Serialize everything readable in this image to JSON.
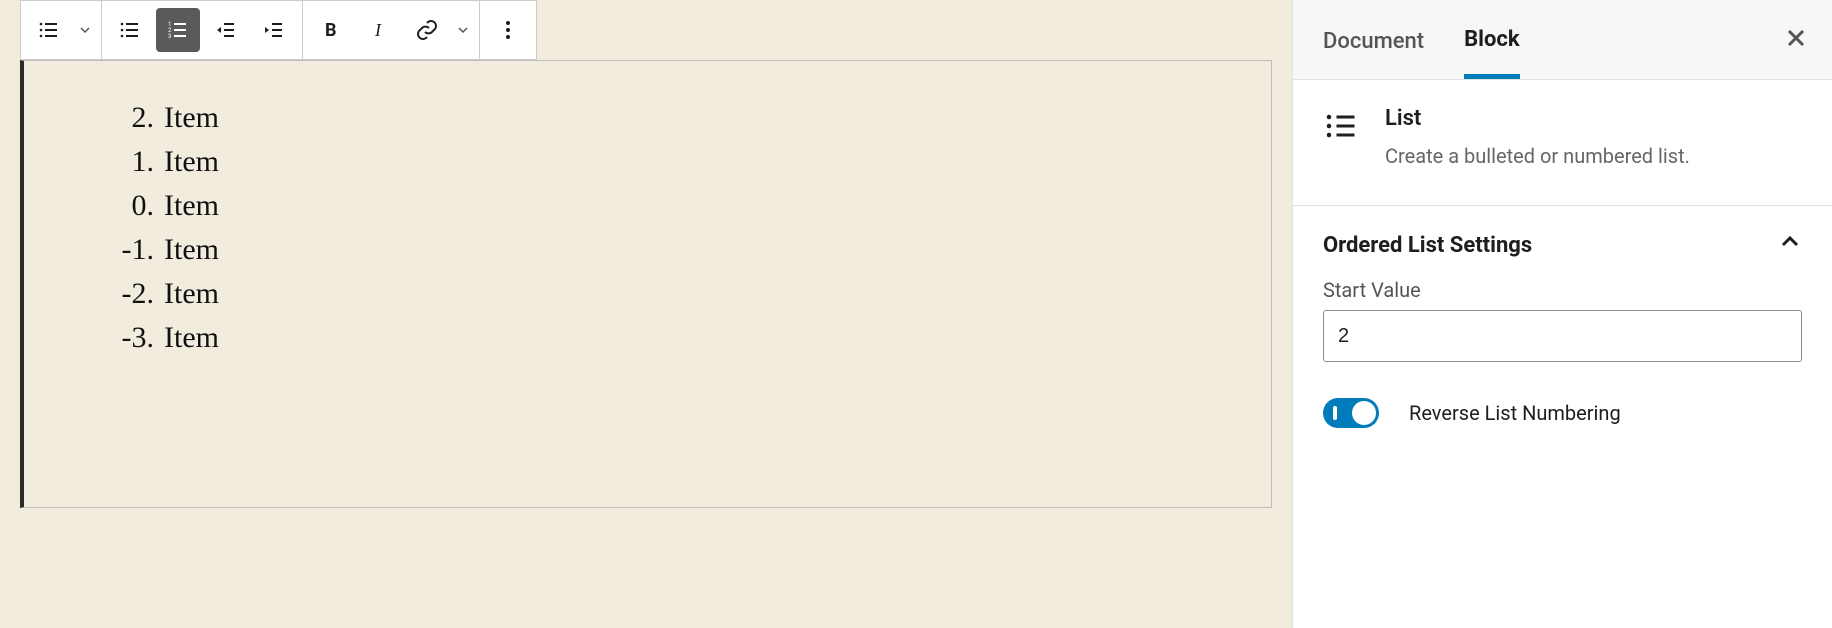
{
  "toolbar": {
    "block_type": "list",
    "list_type": "ordered"
  },
  "list": {
    "items": [
      {
        "num": "2.",
        "text": "Item"
      },
      {
        "num": "1.",
        "text": "Item"
      },
      {
        "num": "0.",
        "text": "Item"
      },
      {
        "num": "-1.",
        "text": "Item"
      },
      {
        "num": "-2.",
        "text": "Item"
      },
      {
        "num": "-3.",
        "text": "Item"
      }
    ]
  },
  "sidebar": {
    "tabs": {
      "document": "Document",
      "block": "Block"
    },
    "block_info": {
      "title": "List",
      "description": "Create a bulleted or numbered list."
    },
    "panel": {
      "title": "Ordered List Settings",
      "start_value_label": "Start Value",
      "start_value": "2",
      "reverse_label": "Reverse List Numbering",
      "reverse_on": true
    }
  }
}
